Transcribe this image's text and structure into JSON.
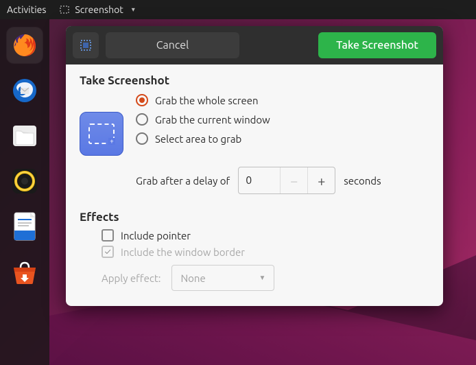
{
  "topbar": {
    "activities": "Activities",
    "app_name": "Screenshot"
  },
  "dock": {
    "items": [
      "firefox",
      "thunderbird",
      "files",
      "rhythmbox",
      "writer",
      "software"
    ]
  },
  "window": {
    "cancel": "Cancel",
    "take": "Take Screenshot",
    "section_title": "Take Screenshot",
    "radio_whole": "Grab the whole screen",
    "radio_window": "Grab the current window",
    "radio_area": "Select area to grab",
    "selected_radio": "whole",
    "delay_prefix": "Grab after a delay of",
    "delay_value": "0",
    "delay_suffix": "seconds",
    "effects_title": "Effects",
    "include_pointer": "Include pointer",
    "include_pointer_checked": false,
    "include_border": "Include the window border",
    "include_border_checked": true,
    "include_border_enabled": false,
    "apply_effect_label": "Apply effect:",
    "apply_effect_value": "None",
    "apply_effect_enabled": false
  }
}
